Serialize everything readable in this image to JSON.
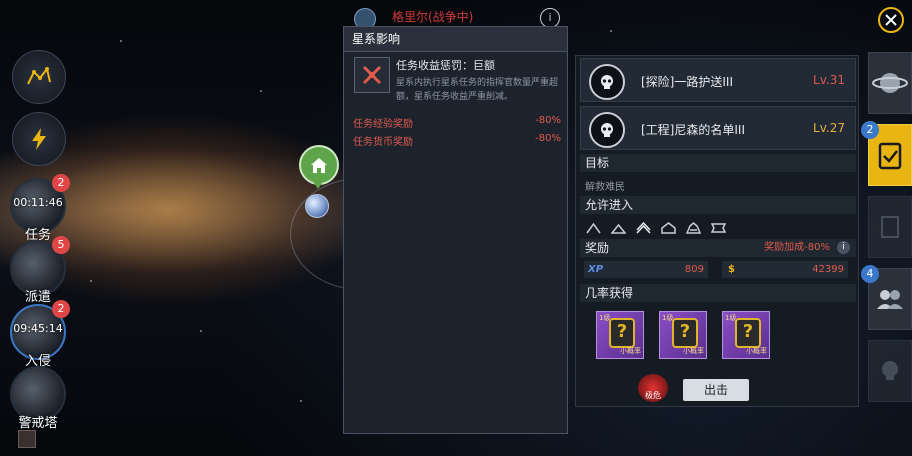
{
  "header": {
    "location_text": "格里尔(战争中)"
  },
  "sidebar": {
    "items": [
      {
        "name": "任务",
        "timer": "00:11:46",
        "badge": "2"
      },
      {
        "name": "派遣",
        "timer": "",
        "badge": "5"
      },
      {
        "name": "入侵",
        "timer": "09:45:14",
        "badge": "2"
      },
      {
        "name": "警戒塔",
        "timer": "",
        "badge": ""
      }
    ]
  },
  "popup": {
    "title": "星系影响",
    "penalty_title": "任务收益惩罚：巨额",
    "penalty_desc": "星系内执行星系任务的指挥官数量严重超额，星系任务收益严重削减。",
    "rows": [
      {
        "label": "任务经验奖励",
        "value": "-80%"
      },
      {
        "label": "任务货币奖励",
        "value": "-80%"
      }
    ]
  },
  "missions": [
    {
      "name": "[探险]一路护送III",
      "level": "Lv.31",
      "level_color": "#e0574a"
    },
    {
      "name": "[工程]尼森的名单III",
      "level": "Lv.27",
      "level_color": "#e8b23a"
    }
  ],
  "detail": {
    "target_label": "目标",
    "target_value": "解救难民",
    "access_label": "允许进入",
    "reward_label": "奖励",
    "reward_bonus": "奖励加成-80%",
    "xp_label": "XP",
    "xp_value": "809",
    "coin_label": "$",
    "coin_value": "42399",
    "drop_label": "几率获得",
    "items": [
      {
        "tag": "小概率",
        "level": "1级"
      },
      {
        "tag": "小概率",
        "level": "1级"
      },
      {
        "tag": "小概率",
        "level": "1级"
      }
    ],
    "go_button": "出击",
    "danger_label": "极危"
  },
  "right_tabs": {
    "mission_badge": "2",
    "team_badge": "4"
  },
  "colors": {
    "accent": "#e8b512",
    "danger": "#e25a4a",
    "badge": "#e04646"
  }
}
